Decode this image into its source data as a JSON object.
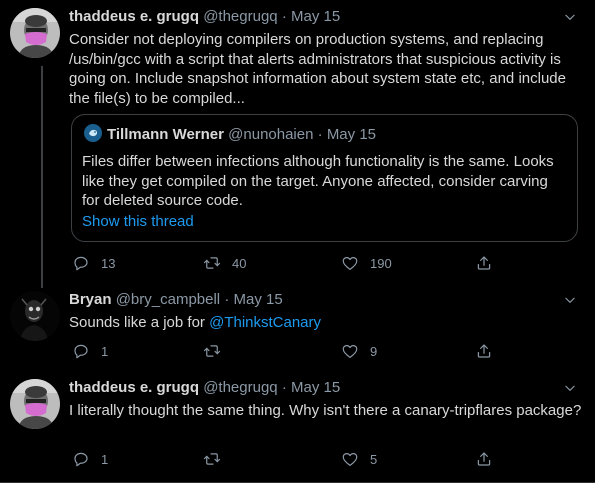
{
  "tweets": [
    {
      "name": "thaddeus e. grugq",
      "handle": "@thegrugq",
      "sep": "·",
      "date": "May 15",
      "text": "Consider not deploying compilers on production systems, and replacing /us/bin/gcc with a script that alerts administrators that suspicious activity is going on. Include snapshot information about system state etc, and include the file(s) to be compiled...",
      "quote": {
        "name": "Tillmann Werner",
        "handle": "@nunohaien",
        "sep": "·",
        "date": "May 15",
        "text": "Files differ between infections although functionality is the same. Looks like they get compiled on the target. Anyone affected, consider carving for deleted source code.",
        "show_thread": "Show this thread"
      },
      "replies": "13",
      "retweets": "40",
      "likes": "190"
    },
    {
      "name": "Bryan",
      "handle": "@bry_campbell",
      "sep": "·",
      "date": "May 15",
      "text_prefix": "Sounds like a job for ",
      "mention": "@ThinkstCanary",
      "replies": "1",
      "retweets": "",
      "likes": "9"
    },
    {
      "name": "thaddeus e. grugq",
      "handle": "@thegrugq",
      "sep": "·",
      "date": "May 15",
      "text": "I literally thought the same thing. Why isn't there a canary-tripflares package?",
      "replies": "1",
      "retweets": "",
      "likes": "5"
    }
  ],
  "icons": {
    "more": "chevron-down-icon",
    "reply": "reply-icon",
    "retweet": "retweet-icon",
    "like": "heart-icon",
    "share": "share-icon"
  },
  "colors": {
    "background": "#000000",
    "text": "#d9d9d9",
    "secondary": "#8b98a5",
    "link": "#1d9bf0",
    "border": "#3d4043"
  }
}
